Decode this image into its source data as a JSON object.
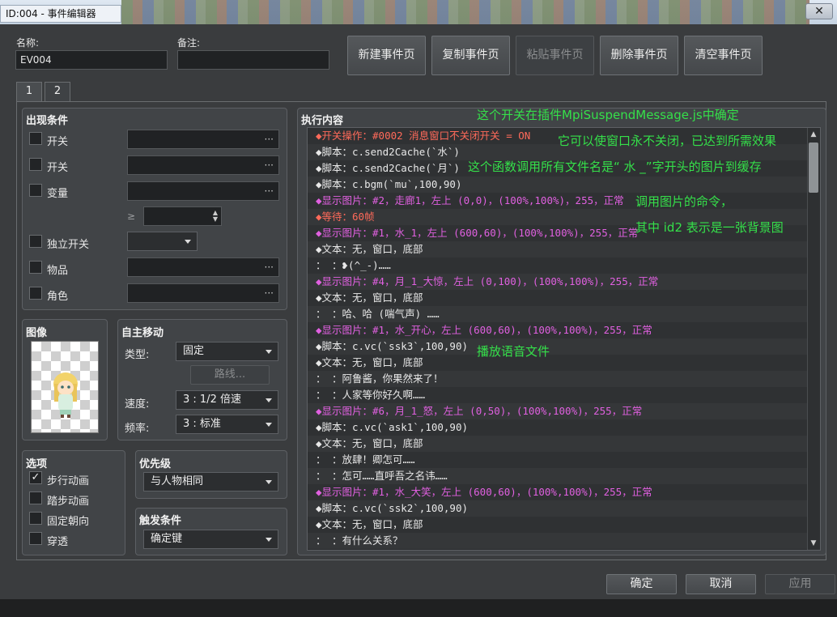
{
  "window": {
    "title": "ID:004 - 事件编辑器",
    "close_glyph": "✕"
  },
  "header": {
    "name_label": "名称:",
    "name_value": "EV004",
    "note_label": "备注:",
    "note_value": "",
    "buttons": {
      "new_page": "新建事件页",
      "copy_page": "复制事件页",
      "paste_page": "粘贴事件页",
      "delete_page": "删除事件页",
      "clear_page": "清空事件页"
    }
  },
  "tabs": [
    "1",
    "2"
  ],
  "conditions": {
    "title": "出现条件",
    "switch1": "开关",
    "switch2": "开关",
    "variable": "变量",
    "gte": "≥",
    "self_switch": "独立开关",
    "item": "物品",
    "actor": "角色",
    "ellipsis": "···"
  },
  "image": {
    "title": "图像"
  },
  "autonomous": {
    "title": "自主移动",
    "type_label": "类型:",
    "type_value": "固定",
    "route_button": "路线...",
    "speed_label": "速度:",
    "speed_value": "3 : 1/2 倍速",
    "freq_label": "频率:",
    "freq_value": "3 : 标准"
  },
  "options": {
    "title": "选项",
    "walk_anim": "步行动画",
    "step_anim": "踏步动画",
    "direction_fix": "固定朝向",
    "through": "穿透",
    "walk_checked_glyph": "✓"
  },
  "priority": {
    "title": "优先级",
    "value": "与人物相同"
  },
  "trigger": {
    "title": "触发条件",
    "value": "确定键"
  },
  "contents": {
    "title": "执行内容",
    "rows": [
      {
        "text": "◆开关操作：#0002 消息窗口不关闭开关 = ON",
        "color": "#ff6a5a"
      },
      {
        "text": "◆脚本：c.send2Cache(`水`)",
        "color": "#e8e8e8"
      },
      {
        "text": "◆脚本：c.send2Cache(`月`)",
        "color": "#e8e8e8"
      },
      {
        "text": "◆脚本：c.bgm(`mu`,100,90)",
        "color": "#e8e8e8"
      },
      {
        "text": "◆显示图片：#2，走廊1，左上 (0,0)，(100%,100%)，255，正常",
        "color": "#e060e0"
      },
      {
        "text": "◆等待：60帧",
        "color": "#ff6a5a"
      },
      {
        "text": "◆显示图片：#1，水_1，左上 (600,60)，(100%,100%)，255，正常",
        "color": "#e060e0"
      },
      {
        "text": "◆文本：无，窗口，底部",
        "color": "#e8e8e8"
      },
      {
        "text": "：    ：❥(^_-)……",
        "color": "#e8e8e8"
      },
      {
        "text": "◆显示图片：#4，月_1_大惊，左上 (0,100)，(100%,100%)，255，正常",
        "color": "#e060e0"
      },
      {
        "text": "◆文本：无，窗口，底部",
        "color": "#e8e8e8"
      },
      {
        "text": "：    ：哈、哈 (喘气声) ……",
        "color": "#e8e8e8"
      },
      {
        "text": "◆显示图片：#1，水_开心，左上 (600,60)，(100%,100%)，255，正常",
        "color": "#e060e0"
      },
      {
        "text": "◆脚本：c.vc(`ssk3`,100,90)",
        "color": "#e8e8e8"
      },
      {
        "text": "◆文本：无，窗口，底部",
        "color": "#e8e8e8"
      },
      {
        "text": "：    ：阿鲁酱，你果然来了！",
        "color": "#e8e8e8"
      },
      {
        "text": "：    ：人家等你好久啊……",
        "color": "#e8e8e8"
      },
      {
        "text": "◆显示图片：#6，月_1_怒，左上 (0,50)，(100%,100%)，255，正常",
        "color": "#e060e0"
      },
      {
        "text": "◆脚本：c.vc(`ask1`,100,90)",
        "color": "#e8e8e8"
      },
      {
        "text": "◆文本：无，窗口，底部",
        "color": "#e8e8e8"
      },
      {
        "text": "：    ：放肆！卿怎可……",
        "color": "#e8e8e8"
      },
      {
        "text": "：    ：怎可……直呼吾之名讳……",
        "color": "#e8e8e8"
      },
      {
        "text": "◆显示图片：#1，水_大笑，左上 (600,60)，(100%,100%)，255，正常",
        "color": "#e060e0"
      },
      {
        "text": "◆脚本：c.vc(`ssk2`,100,90)",
        "color": "#e8e8e8"
      },
      {
        "text": "◆文本：无，窗口，底部",
        "color": "#e8e8e8"
      },
      {
        "text": "：    ：有什么关系？",
        "color": "#e8e8e8"
      }
    ]
  },
  "annotations": {
    "a1": "这个开关在插件MpiSuspendMessage.js中确定",
    "a2": "它可以使窗口永不关闭，已达到所需效果",
    "a3": "这个函数调用所有文件名是“ 水 _”字开头的图片到缓存",
    "a4": "调用图片的命令，",
    "a5": "其中 id2 表示是一张背景图",
    "a6": "播放语音文件",
    "color": "#35e04a"
  },
  "footer": {
    "ok": "确定",
    "cancel": "取消",
    "apply": "应用"
  }
}
